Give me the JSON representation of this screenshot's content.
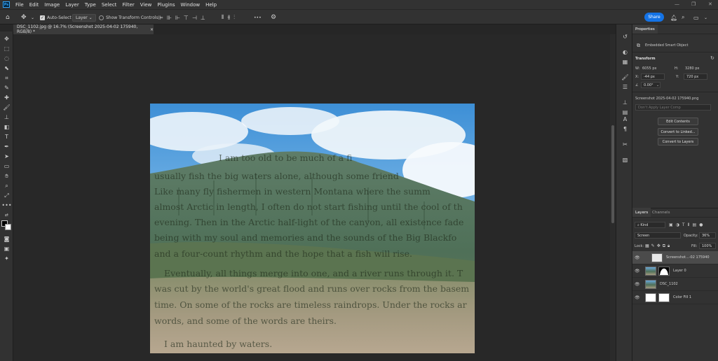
{
  "menubar": {
    "app_logo": "Ps",
    "items": [
      "File",
      "Edit",
      "Image",
      "Layer",
      "Type",
      "Select",
      "Filter",
      "View",
      "Plugins",
      "Window",
      "Help"
    ]
  },
  "options": {
    "auto_select_label": "Auto-Select",
    "layer_dropdown": "Layer",
    "show_transform_label": "Show Transform Controls",
    "more_label": "•••",
    "share_label": "Share"
  },
  "document_tab": {
    "title": "DSC_1102.jpg @ 16.7% (Screenshot 2025-04-02 175940, RGB/8) *",
    "close": "×"
  },
  "image_text": {
    "lines": [
      "I am too old to be much of a fi",
      "usually fish the big waters alone, although some friend",
      "Like many fly fishermen in western Montana where the summ",
      "almost Arctic in length, I often do not start fishing until the cool of th",
      "evening. Then in the Arctic half-light of the canyon, all existence fade",
      "being with my soul and memories and the sounds of the Big Blackfo",
      "and a four-count rhythm and the hope that a fish will rise.",
      "Eventually, all things merge into one, and a river runs through it. T",
      "was cut by the world's great flood and runs over rocks from the basem",
      "time. On some of the rocks are timeless raindrops. Under the rocks ar",
      "words, and some of the words are theirs.",
      "I am haunted by waters."
    ]
  },
  "properties": {
    "tab_label": "Properties",
    "object_type": "Embedded Smart Object",
    "transform_label": "Transform",
    "w_label": "W:",
    "w_value": "6055 px",
    "h_label": "H:",
    "h_value": "3280 px",
    "x_label": "X:",
    "x_value": "-44 px",
    "y_label": "Y:",
    "y_value": "720 px",
    "angle_value": "0.00°",
    "source_file": "Screenshot 2025-04-02 175940.png",
    "layer_comp": "Don't Apply Layer Comp",
    "edit_contents": "Edit Contents",
    "convert_linked": "Convert to Linked...",
    "convert_layers": "Convert to Layers"
  },
  "layers_panel": {
    "tab_layers": "Layers",
    "tab_channels": "Channels",
    "kind_label": "Kind",
    "blend_mode": "Screen",
    "opacity_label": "Opacity:",
    "opacity_value": "36%",
    "lock_label": "Lock:",
    "fill_label": "Fill:",
    "fill_value": "100%",
    "layers": [
      {
        "name": "Screenshot...-02 175940",
        "selected": true
      },
      {
        "name": "Layer 0",
        "selected": false
      },
      {
        "name": "DSC_1102",
        "selected": false
      },
      {
        "name": "Color Fill 1",
        "selected": false
      }
    ]
  },
  "colors": {
    "accent": "#1473e6",
    "panel_bg": "#323232",
    "canvas_bg": "#282828"
  }
}
